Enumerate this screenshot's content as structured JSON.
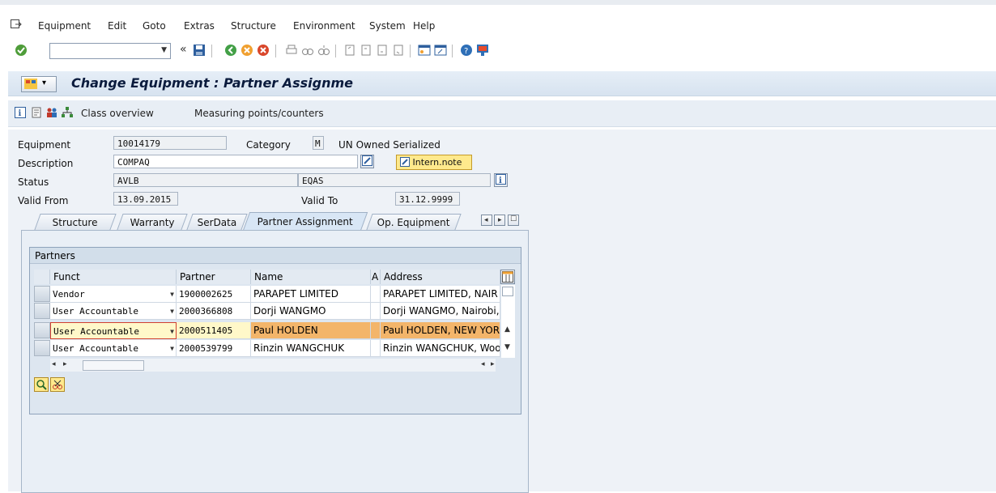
{
  "menu": {
    "items": [
      "Equipment",
      "Edit",
      "Goto",
      "Extras",
      "Structure",
      "Environment",
      "System",
      "Help"
    ]
  },
  "toolbar": {
    "command_value": "",
    "icons": [
      "check-icon",
      "back-arrows-icon",
      "save-icon",
      "back-icon",
      "exit-icon",
      "cancel-icon",
      "print-icon",
      "find-icon",
      "find-next-icon",
      "first-page-icon",
      "prev-page-icon",
      "next-page-icon",
      "last-page-icon",
      "new-session-icon",
      "shortcut-icon",
      "help-icon",
      "customize-icon"
    ]
  },
  "title": {
    "text": "Change Equipment : Partner Assignme"
  },
  "app_toolbar": {
    "class_overview": "Class overview",
    "measuring_points": "Measuring points/counters"
  },
  "form": {
    "equipment_label": "Equipment",
    "equipment_value": "10014179",
    "category_label": "Category",
    "category_value": "M",
    "category_text": "UN Owned Serialized",
    "description_label": "Description",
    "description_value": "COMPAQ",
    "intern_note": "Intern.note",
    "status_label": "Status",
    "status_value": "AVLB",
    "status2_value": "EQAS",
    "valid_from_label": "Valid From",
    "valid_from_value": "13.09.2015",
    "valid_to_label": "Valid To",
    "valid_to_value": "31.12.9999"
  },
  "tabs": [
    "Structure",
    "Warranty",
    "SerData",
    "Partner Assignment",
    "Op. Equipment"
  ],
  "active_tab": "Partner Assignment",
  "partners": {
    "title": "Partners",
    "columns": [
      "Funct",
      "Partner",
      "Name",
      "A",
      "Address"
    ],
    "rows": [
      {
        "funct": "Vendor",
        "partner": "1900002625",
        "name": "PARAPET LIMITED",
        "address": "PARAPET LIMITED, NAIR"
      },
      {
        "funct": "User Accountable",
        "partner": "2000366808",
        "name": "Dorji WANGMO",
        "address": "Dorji WANGMO, Nairobi, ,"
      },
      {
        "funct": "User Accountable",
        "partner": "2000511405",
        "name": "Paul HOLDEN",
        "address": "Paul HOLDEN, NEW YOR"
      },
      {
        "funct": "User Accountable",
        "partner": "2000539799",
        "name": "Rinzin WANGCHUK",
        "address": "Rinzin WANGCHUK, Wooc"
      }
    ],
    "selected_row": 2
  },
  "colors": {
    "selection": "#f3b56a",
    "editable": "#fff8c9",
    "note_button": "#ffe98c"
  }
}
